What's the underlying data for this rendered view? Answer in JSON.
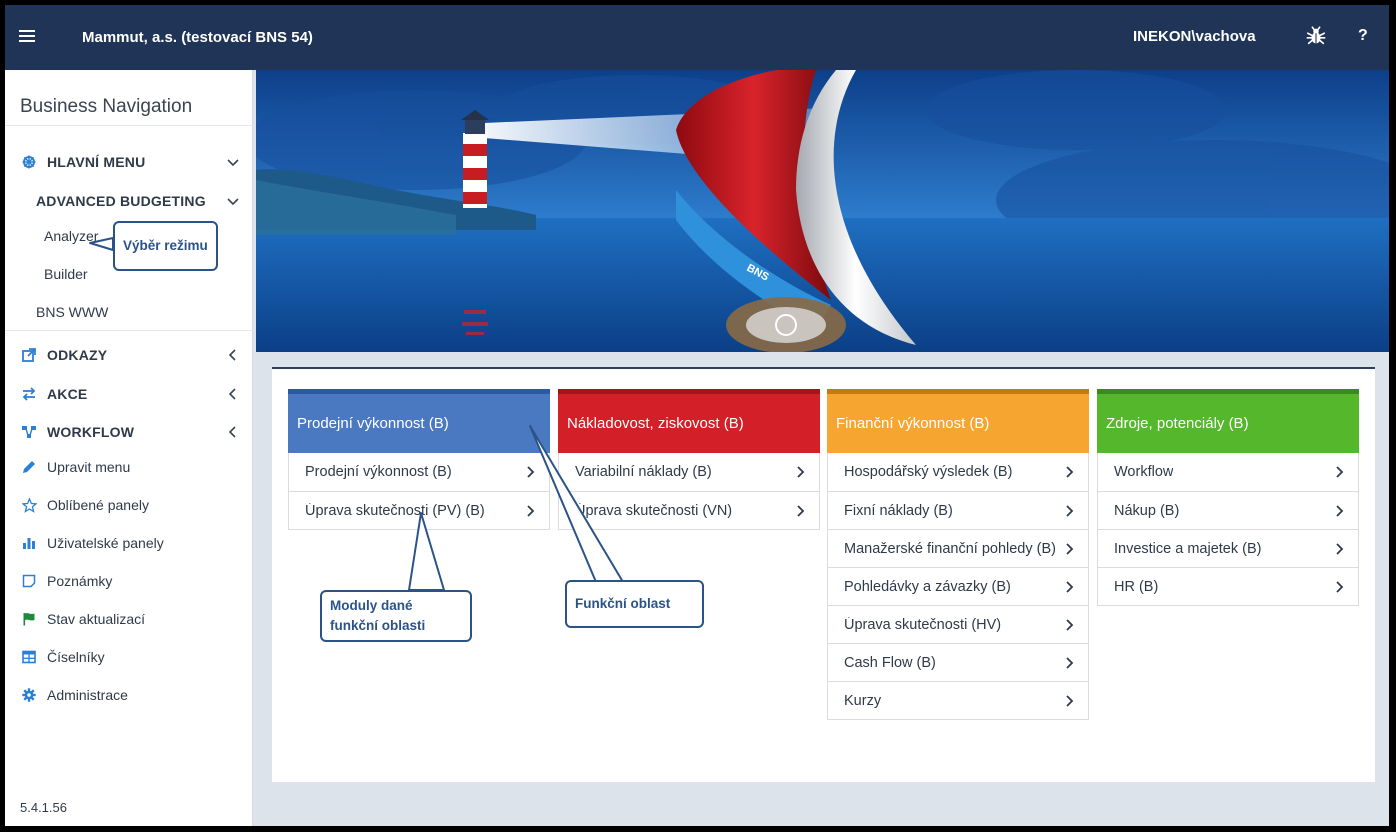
{
  "topbar": {
    "title": "Mammut, a.s. (testovací BNS 54)",
    "user": "INEKON\\vachova",
    "help_label": "?"
  },
  "sidebar": {
    "title": "Business Navigation",
    "main_menu": "HLAVNÍ MENU",
    "advanced_budgeting": "ADVANCED BUDGETING",
    "analyzer": "Analyzer",
    "builder": "Builder",
    "bns_www": "BNS WWW",
    "odkazy": "ODKAZY",
    "akce": "AKCE",
    "workflow": "WORKFLOW",
    "items": [
      {
        "label": "Upravit menu",
        "icon": "pencil-icon"
      },
      {
        "label": "Oblíbené panely",
        "icon": "star-icon"
      },
      {
        "label": "Uživatelské panely",
        "icon": "bar-chart-icon"
      },
      {
        "label": "Poznámky",
        "icon": "note-icon"
      },
      {
        "label": "Stav aktualizací",
        "icon": "flag-icon"
      },
      {
        "label": "Číselníky",
        "icon": "table-icon"
      },
      {
        "label": "Administrace",
        "icon": "gear-icon"
      }
    ],
    "version": "5.4.1.56"
  },
  "colors": {
    "topbar": "#1f3457",
    "accent_icon": "#2b7fd4",
    "tile_blue": "#4a79c2",
    "tile_red": "#d32028",
    "tile_orange": "#f7a531",
    "tile_green": "#55b72c"
  },
  "tiles": [
    {
      "header": "Prodejní výkonnost (B)",
      "color": "#4a79c2",
      "stripe": "#2c58a6",
      "rows": [
        "Prodejní výkonnost (B)",
        "Úprava skutečnosti (PV) (B)"
      ]
    },
    {
      "header": "Nákladovost, ziskovost (B)",
      "color": "#d32028",
      "stripe": "#a5141a",
      "rows": [
        "Variabilní náklady (B)",
        "Úprava skutečnosti (VN)"
      ]
    },
    {
      "header": "Finanční výkonnost (B)",
      "color": "#f7a531",
      "stripe": "#c57a13",
      "rows": [
        "Hospodářský výsledek (B)",
        "Fixní náklady (B)",
        "Manažerské finanční pohledy (B)",
        "Pohledávky a závazky (B)",
        "Úprava skutečnosti (HV)",
        "Cash Flow (B)",
        "Kurzy"
      ]
    },
    {
      "header": "Zdroje, potenciály (B)",
      "color": "#55b72c",
      "stripe": "#3a8a1c",
      "rows": [
        "Workflow",
        "Nákup (B)",
        "Investice a majetek (B)",
        "HR (B)"
      ]
    }
  ],
  "callouts": {
    "vyber_rezimu": "Výběr režimu",
    "moduly_1": "Moduly dané",
    "moduly_2": "funkční oblasti",
    "funkcni_oblast": "Funkční oblast"
  },
  "banner": {
    "sail_text": "BNS"
  }
}
